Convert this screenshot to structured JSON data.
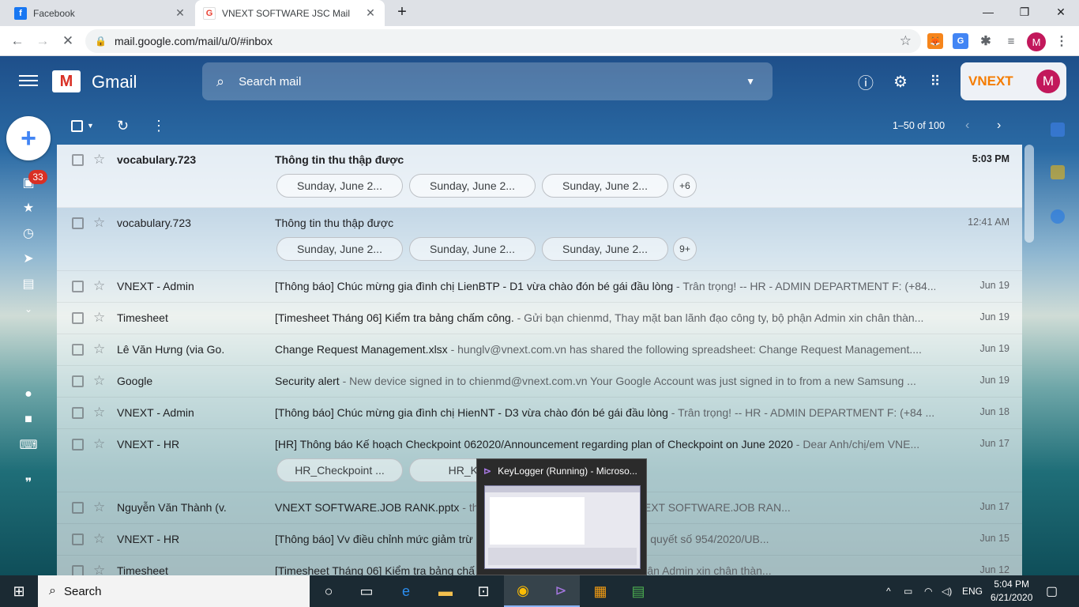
{
  "browser": {
    "tabs": [
      {
        "title": "Facebook",
        "favicon": "facebook-icon",
        "active": false
      },
      {
        "title": "VNEXT SOFTWARE JSC Mail",
        "favicon": "gmail-icon",
        "active": true
      }
    ],
    "new_tab_label": "+",
    "url": "mail.google.com/mail/u/0/#inbox",
    "profile_initial": "M"
  },
  "gmail": {
    "logo_text": "Gmail",
    "search_placeholder": "Search mail",
    "org_name": "VNEXT",
    "account_initial": "M",
    "inbox_badge": "33",
    "pagination": "1–50 of 100",
    "emails": [
      {
        "sender": "vocabulary.723",
        "subject": "Thông tin thu thập được",
        "snippet": "",
        "date": "5:03 PM",
        "unread": true,
        "chips": [
          "Sunday, June 2...",
          "Sunday, June 2...",
          "Sunday, June 2..."
        ],
        "more": "+6"
      },
      {
        "sender": "vocabulary.723",
        "subject": "Thông tin thu thập được",
        "snippet": "",
        "date": "12:41 AM",
        "unread": false,
        "chips": [
          "Sunday, June 2...",
          "Sunday, June 2...",
          "Sunday, June 2..."
        ],
        "more": "9+"
      },
      {
        "sender": "VNEXT - Admin",
        "subject": "[Thông báo] Chúc mừng gia đình chị LienBTP - D1 vừa chào đón bé gái đầu lòng",
        "snippet": " - Trân trọng! -- HR - ADMIN DEPARTMENT F: (+84...",
        "date": "Jun 19",
        "unread": false
      },
      {
        "sender": "Timesheet",
        "subject": "[Timesheet Tháng 06] Kiểm tra bảng chấm công.",
        "snippet": " - Gửi bạn chienmd, Thay mặt ban lãnh đạo công ty, bộ phận Admin xin chân thàn...",
        "date": "Jun 19",
        "unread": false
      },
      {
        "sender": "Lê Văn Hưng (via Go.",
        "subject": "Change Request Management.xlsx",
        "snippet": " - hunglv@vnext.com.vn has shared the following spreadsheet: Change Request Management....",
        "date": "Jun 19",
        "unread": false
      },
      {
        "sender": "Google",
        "subject": "Security alert",
        "snippet": " - New device signed in to chienmd@vnext.com.vn Your Google Account was just signed in to from a new Samsung ...",
        "date": "Jun 19",
        "unread": false
      },
      {
        "sender": "VNEXT - Admin",
        "subject": "[Thông báo] Chúc mừng gia đình chị HienNT - D3 vừa chào đón bé gái đầu lòng",
        "snippet": " - Trân trọng! -- HR - ADMIN DEPARTMENT F: (+84 ...",
        "date": "Jun 18",
        "unread": false
      },
      {
        "sender": "VNEXT - HR",
        "subject": "[HR] Thông báo Kế hoạch Checkpoint 062020/Announcement regarding plan of Checkpoint on June 2020",
        "snippet": " - Dear Anh/chị/em VNE...",
        "date": "Jun 17",
        "unread": false,
        "chips": [
          "HR_Checkpoint ...",
          "HR_Ke ..."
        ],
        "more": ""
      },
      {
        "sender": "Nguyễn Văn Thành (v.",
        "subject": "VNEXT SOFTWARE.JOB RANK.pptx",
        "snippet": " - tha... the following presentation: VNEXT SOFTWARE.JOB RAN...",
        "date": "Jun 17",
        "unread": false
      },
      {
        "sender": "VNEXT - HR",
        "subject": "[Thông báo] Vv điều chỉnh mức giảm trừ",
        "snippet": " ... nh/chị/em VNEXTers, Theo Nghị quyết số 954/2020/UB...",
        "date": "Jun 15",
        "unread": false
      },
      {
        "sender": "Timesheet",
        "subject": "[Timesheet Tháng 06] Kiểm tra bảng chấ",
        "snippet": " ... mặt ban lãnh đạo công ty, bộ phận Admin xin chân thàn...",
        "date": "Jun 12",
        "unread": false
      }
    ]
  },
  "taskbar_preview": {
    "title": "KeyLogger (Running) - Microso..."
  },
  "taskbar": {
    "search_label": "Search",
    "language": "ENG",
    "time": "5:04 PM",
    "date": "6/21/2020"
  }
}
